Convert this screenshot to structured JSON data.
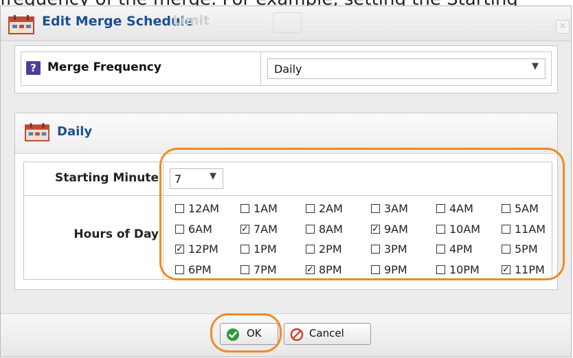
{
  "background": {
    "clipped_text": "frequency of the merge. For example, setting the Starting"
  },
  "dialog": {
    "title": "Edit Merge Schedule",
    "ghost_title": "Limit",
    "close_glyph": "✕",
    "title_icon": "schedule-calendar-icon"
  },
  "frequency": {
    "help_glyph": "?",
    "label": "Merge Frequency",
    "value": "Daily",
    "caret": "▼"
  },
  "daily": {
    "title": "Daily",
    "starting_minute_label": "Starting Minute",
    "starting_minute_value": "7",
    "hours_label": "Hours of Day",
    "hours": [
      [
        {
          "label": "12AM",
          "checked": false
        },
        {
          "label": "1AM",
          "checked": false
        },
        {
          "label": "2AM",
          "checked": false
        },
        {
          "label": "3AM",
          "checked": false
        },
        {
          "label": "4AM",
          "checked": false
        },
        {
          "label": "5AM",
          "checked": false
        }
      ],
      [
        {
          "label": "6AM",
          "checked": false
        },
        {
          "label": "7AM",
          "checked": true
        },
        {
          "label": "8AM",
          "checked": false
        },
        {
          "label": "9AM",
          "checked": true
        },
        {
          "label": "10AM",
          "checked": false
        },
        {
          "label": "11AM",
          "checked": false
        }
      ],
      [
        {
          "label": "12PM",
          "checked": true
        },
        {
          "label": "1PM",
          "checked": false
        },
        {
          "label": "2PM",
          "checked": false
        },
        {
          "label": "3PM",
          "checked": false
        },
        {
          "label": "4PM",
          "checked": false
        },
        {
          "label": "5PM",
          "checked": false
        }
      ],
      [
        {
          "label": "6PM",
          "checked": false
        },
        {
          "label": "7PM",
          "checked": false
        },
        {
          "label": "8PM",
          "checked": true
        },
        {
          "label": "9PM",
          "checked": false
        },
        {
          "label": "10PM",
          "checked": false
        },
        {
          "label": "11PM",
          "checked": true
        }
      ]
    ]
  },
  "footer": {
    "ok_label": "OK",
    "cancel_label": "Cancel"
  },
  "colors": {
    "title": "#1d4f91",
    "annotation": "#ef8a22",
    "ok_green": "#2e9a3a",
    "cancel_red": "#d23a2a"
  }
}
